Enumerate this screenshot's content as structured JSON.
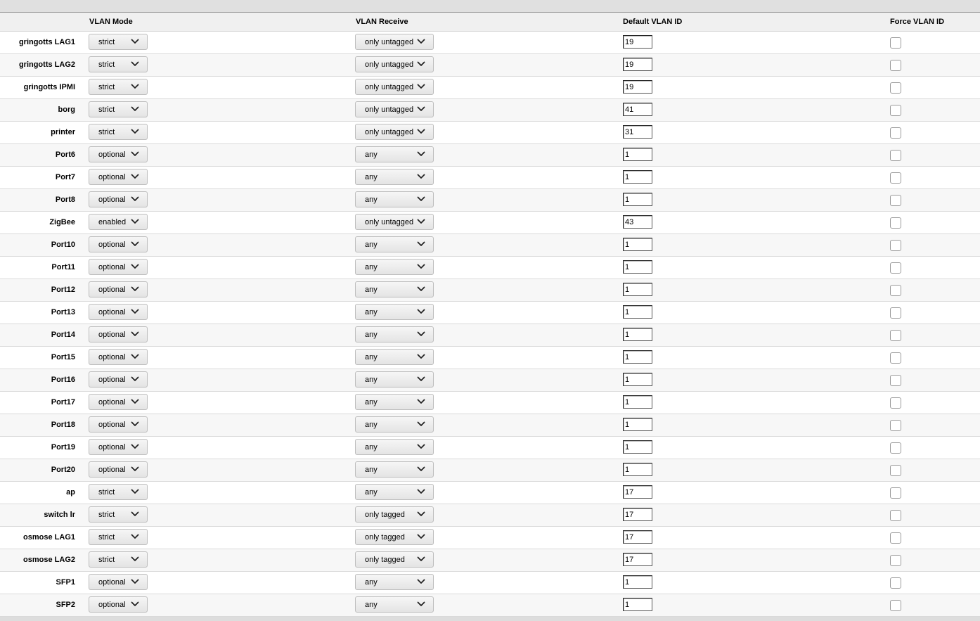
{
  "headers": {
    "mode": "VLAN Mode",
    "receive": "VLAN Receive",
    "default_id": "Default VLAN ID",
    "force": "Force VLAN ID"
  },
  "icons": {
    "dropdown": "chevron-down-icon"
  },
  "ports": [
    {
      "name": "gringotts LAG1",
      "mode": "strict",
      "receive": "only untagged",
      "vlan_id": "19",
      "force": false
    },
    {
      "name": "gringotts LAG2",
      "mode": "strict",
      "receive": "only untagged",
      "vlan_id": "19",
      "force": false
    },
    {
      "name": "gringotts IPMI",
      "mode": "strict",
      "receive": "only untagged",
      "vlan_id": "19",
      "force": false
    },
    {
      "name": "borg",
      "mode": "strict",
      "receive": "only untagged",
      "vlan_id": "41",
      "force": false
    },
    {
      "name": "printer",
      "mode": "strict",
      "receive": "only untagged",
      "vlan_id": "31",
      "force": false
    },
    {
      "name": "Port6",
      "mode": "optional",
      "receive": "any",
      "vlan_id": "1",
      "force": false
    },
    {
      "name": "Port7",
      "mode": "optional",
      "receive": "any",
      "vlan_id": "1",
      "force": false
    },
    {
      "name": "Port8",
      "mode": "optional",
      "receive": "any",
      "vlan_id": "1",
      "force": false
    },
    {
      "name": "ZigBee",
      "mode": "enabled",
      "receive": "only untagged",
      "vlan_id": "43",
      "force": false
    },
    {
      "name": "Port10",
      "mode": "optional",
      "receive": "any",
      "vlan_id": "1",
      "force": false
    },
    {
      "name": "Port11",
      "mode": "optional",
      "receive": "any",
      "vlan_id": "1",
      "force": false
    },
    {
      "name": "Port12",
      "mode": "optional",
      "receive": "any",
      "vlan_id": "1",
      "force": false
    },
    {
      "name": "Port13",
      "mode": "optional",
      "receive": "any",
      "vlan_id": "1",
      "force": false
    },
    {
      "name": "Port14",
      "mode": "optional",
      "receive": "any",
      "vlan_id": "1",
      "force": false
    },
    {
      "name": "Port15",
      "mode": "optional",
      "receive": "any",
      "vlan_id": "1",
      "force": false
    },
    {
      "name": "Port16",
      "mode": "optional",
      "receive": "any",
      "vlan_id": "1",
      "force": false
    },
    {
      "name": "Port17",
      "mode": "optional",
      "receive": "any",
      "vlan_id": "1",
      "force": false
    },
    {
      "name": "Port18",
      "mode": "optional",
      "receive": "any",
      "vlan_id": "1",
      "force": false
    },
    {
      "name": "Port19",
      "mode": "optional",
      "receive": "any",
      "vlan_id": "1",
      "force": false
    },
    {
      "name": "Port20",
      "mode": "optional",
      "receive": "any",
      "vlan_id": "1",
      "force": false
    },
    {
      "name": "ap",
      "mode": "strict",
      "receive": "any",
      "vlan_id": "17",
      "force": false
    },
    {
      "name": "switch lr",
      "mode": "strict",
      "receive": "only tagged",
      "vlan_id": "17",
      "force": false
    },
    {
      "name": "osmose LAG1",
      "mode": "strict",
      "receive": "only tagged",
      "vlan_id": "17",
      "force": false
    },
    {
      "name": "osmose LAG2",
      "mode": "strict",
      "receive": "only tagged",
      "vlan_id": "17",
      "force": false
    },
    {
      "name": "SFP1",
      "mode": "optional",
      "receive": "any",
      "vlan_id": "1",
      "force": false
    },
    {
      "name": "SFP2",
      "mode": "optional",
      "receive": "any",
      "vlan_id": "1",
      "force": false
    }
  ]
}
